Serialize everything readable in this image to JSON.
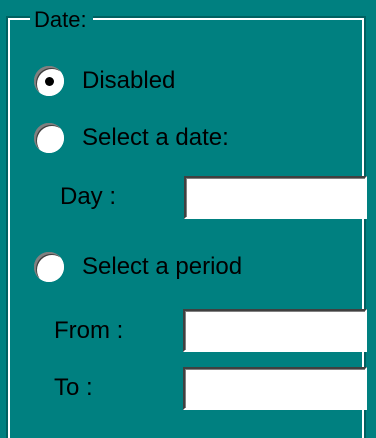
{
  "group": {
    "legend": "Date:"
  },
  "options": {
    "disabled": {
      "label": "Disabled",
      "selected": true
    },
    "select_date": {
      "label": "Select a date:",
      "selected": false
    },
    "select_period": {
      "label": "Select a period",
      "selected": false
    }
  },
  "fields": {
    "day": {
      "label": "Day :",
      "value": ""
    },
    "from": {
      "label": "From :",
      "value": ""
    },
    "to": {
      "label": "To :",
      "value": ""
    }
  }
}
